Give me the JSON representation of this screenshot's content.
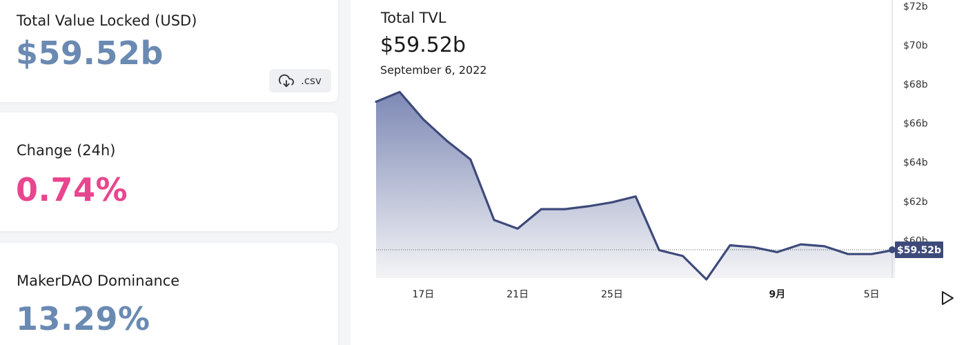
{
  "stats": {
    "tvl": {
      "label": "Total Value Locked (USD)",
      "value": "$59.52b"
    },
    "change": {
      "label": "Change (24h)",
      "value": "0.74%"
    },
    "dominance": {
      "label": "MakerDAO Dominance",
      "value": "13.29%"
    },
    "csv_label": ".csv"
  },
  "chart_header": {
    "title": "Total TVL",
    "value": "$59.52b",
    "date": "September 6, 2022"
  },
  "chart_data": {
    "type": "area",
    "x": [
      "Aug 15",
      "Aug 16",
      "Aug 17",
      "Aug 18",
      "Aug 19",
      "Aug 20",
      "Aug 21",
      "Aug 22",
      "Aug 23",
      "Aug 24",
      "Aug 25",
      "Aug 26",
      "Aug 27",
      "Aug 28",
      "Aug 29",
      "Aug 30",
      "Aug 31",
      "Sep 1",
      "Sep 2",
      "Sep 3",
      "Sep 4",
      "Sep 5",
      "Sep 6"
    ],
    "values": [
      67.1,
      67.6,
      66.2,
      65.1,
      64.15,
      61.05,
      60.6,
      61.6,
      61.6,
      61.75,
      61.95,
      62.25,
      59.5,
      59.2,
      58.0,
      59.75,
      59.65,
      59.4,
      59.8,
      59.7,
      59.3,
      59.3,
      59.52
    ],
    "x_ticks": [
      {
        "label": "17日",
        "index": 2,
        "bold": false
      },
      {
        "label": "21日",
        "index": 6,
        "bold": false
      },
      {
        "label": "25日",
        "index": 10,
        "bold": false
      },
      {
        "label": "9月",
        "index": 17,
        "bold": true
      },
      {
        "label": "5日",
        "index": 21,
        "bold": false
      }
    ],
    "y_ticks": [
      {
        "label": "$60b",
        "value": 60
      },
      {
        "label": "$62b",
        "value": 62
      },
      {
        "label": "$64b",
        "value": 64
      },
      {
        "label": "$66b",
        "value": 66
      },
      {
        "label": "$68b",
        "value": 68
      },
      {
        "label": "$70b",
        "value": 70
      },
      {
        "label": "$72b",
        "value": 72
      }
    ],
    "ylim": [
      57.5,
      72
    ],
    "current_value": 59.52,
    "current_label": "$59.52b",
    "line_color": "#3d4a7a",
    "fill_color_top": "#6f7cad",
    "fill_color_bottom": "#f4f4f6"
  }
}
